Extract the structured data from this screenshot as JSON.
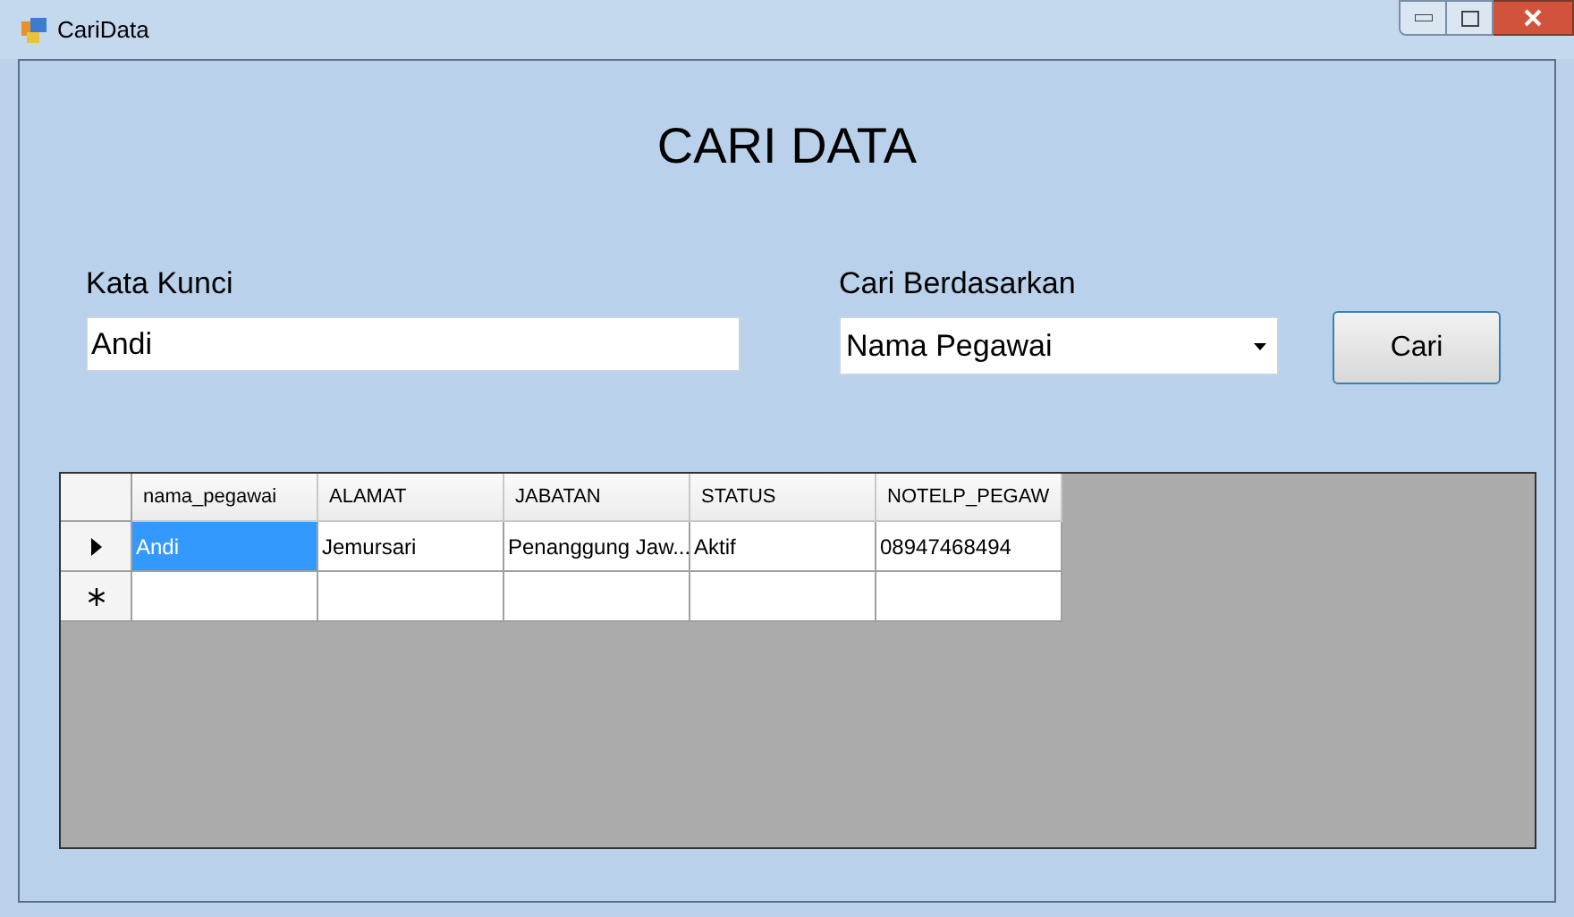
{
  "window": {
    "title": "CariData"
  },
  "heading": "CARI DATA",
  "keyword": {
    "label": "Kata Kunci",
    "value": "Andi"
  },
  "search_by": {
    "label": "Cari Berdasarkan",
    "value": "Nama Pegawai"
  },
  "search_button": "Cari",
  "table": {
    "columns": [
      "nama_pegawai",
      "ALAMAT",
      "JABATAN",
      "STATUS",
      "NOTELP_PEGAW"
    ],
    "rows": [
      {
        "kind": "current",
        "cells": [
          {
            "text": "Andi",
            "selected": true
          },
          {
            "text": "Jemursari",
            "selected": false
          },
          {
            "text": "Penanggung Jaw...",
            "selected": false
          },
          {
            "text": "Aktif",
            "selected": false
          },
          {
            "text": "08947468494",
            "selected": false
          }
        ]
      },
      {
        "kind": "new",
        "cells": [
          {
            "text": "",
            "selected": false
          },
          {
            "text": "",
            "selected": false
          },
          {
            "text": "",
            "selected": false
          },
          {
            "text": "",
            "selected": false
          },
          {
            "text": "",
            "selected": false
          }
        ]
      }
    ]
  }
}
